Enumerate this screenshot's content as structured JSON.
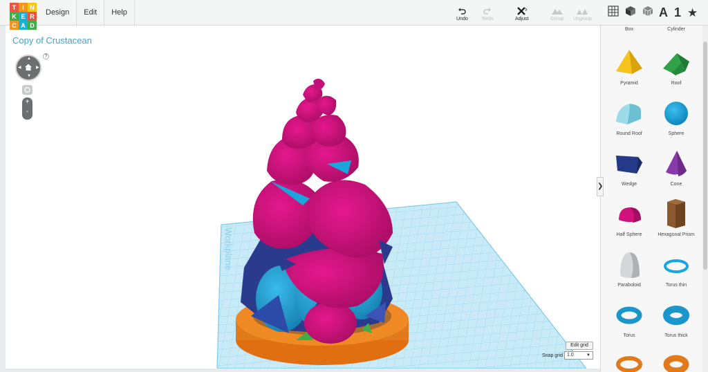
{
  "app": {
    "logo_letters": [
      "T",
      "I",
      "N",
      "K",
      "E",
      "R",
      "C",
      "A",
      "D"
    ],
    "logo_colors": [
      "#e8573f",
      "#f7941d",
      "#f9c80e",
      "#3fae49",
      "#1eaeda",
      "#e8573f",
      "#f7941d",
      "#1eaeda",
      "#3fae49"
    ]
  },
  "menu": {
    "items": [
      {
        "label": "Design"
      },
      {
        "label": "Edit"
      },
      {
        "label": "Help"
      }
    ]
  },
  "toolbar": {
    "undo": {
      "label": "Undo",
      "icon": "undo-icon"
    },
    "redo": {
      "label": "Redo",
      "icon": "redo-icon",
      "disabled": true
    },
    "adjust": {
      "label": "Adjust",
      "icon": "adjust-icon"
    },
    "group": {
      "label": "Group",
      "icon": "group-icon",
      "disabled": true
    },
    "ungroup": {
      "label": "Ungroup",
      "icon": "ungroup-icon",
      "disabled": true
    }
  },
  "view_buttons": {
    "text_label": "A",
    "number_label": "1",
    "icons": [
      "grid-view-icon",
      "solid-view-icon",
      "transparent-view-icon",
      "text-tool-icon",
      "number-tool-icon",
      "favorites-star-icon"
    ]
  },
  "workspace": {
    "title": "Copy of Crustacean",
    "help": "?",
    "workplane_label": "Workplane",
    "zoom_in": "+",
    "zoom_out": "-",
    "edit_grid": "Edit grid",
    "snap_grid_label": "Snap grid",
    "snap_grid_value": "1.0"
  },
  "shapes": [
    {
      "label": "Box",
      "icon": "box-icon"
    },
    {
      "label": "Cylinder",
      "icon": "cylinder-icon"
    },
    {
      "label": "Pyramid",
      "icon": "pyramid-icon"
    },
    {
      "label": "Roof",
      "icon": "roof-icon"
    },
    {
      "label": "Round Roof",
      "icon": "round-roof-icon"
    },
    {
      "label": "Sphere",
      "icon": "sphere-icon"
    },
    {
      "label": "Wedge",
      "icon": "wedge-icon"
    },
    {
      "label": "Cone",
      "icon": "cone-icon"
    },
    {
      "label": "Half Sphere",
      "icon": "half-sphere-icon"
    },
    {
      "label": "Hexagonal Prism",
      "icon": "hexagonal-prism-icon"
    },
    {
      "label": "Paraboloid",
      "icon": "paraboloid-icon"
    },
    {
      "label": "Torus thin",
      "icon": "torus-thin-icon"
    },
    {
      "label": "Torus",
      "icon": "torus-icon"
    },
    {
      "label": "Torus thick",
      "icon": "torus-thick-icon"
    }
  ],
  "colors": {
    "accent": "#4a9fc7",
    "magenta": "#d0137c",
    "cyan": "#1aa6da",
    "navy": "#2a3a8c",
    "orange": "#f08a24",
    "grid": "#a9dcef"
  }
}
